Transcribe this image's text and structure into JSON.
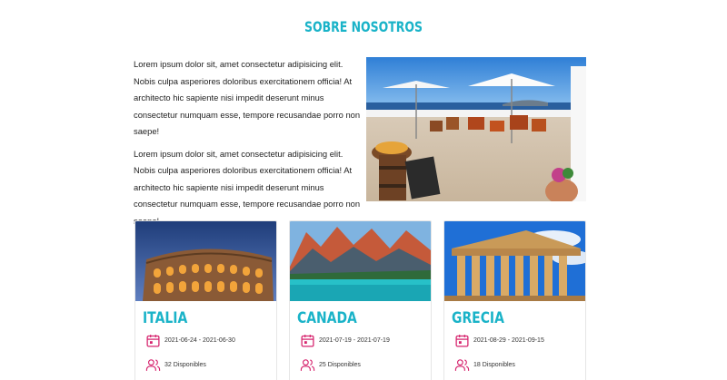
{
  "about": {
    "title": "SOBRE NOSOTROS",
    "paragraphs": [
      "Lorem ipsum dolor sit, amet consectetur adipisicing elit. Nobis culpa asperiores doloribus exercitationem officia! At architecto hic sapiente nisi impedit deserunt minus consectetur numquam esse, tempore recusandae porro non saepe!",
      "Lorem ipsum dolor sit, amet consectetur adipisicing elit. Nobis culpa asperiores doloribus exercitationem officia! At architecto hic sapiente nisi impedit deserunt minus consectetur numquam esse, tempore recusandae porro non saepe!"
    ]
  },
  "trips": [
    {
      "name": "ITALIA",
      "dates": "2021-06-24 - 2021-06-30",
      "availability": "32 Disponibles"
    },
    {
      "name": "CANADA",
      "dates": "2021-07-19 - 2021-07-19",
      "availability": "25 Disponibles"
    },
    {
      "name": "GRECIA",
      "dates": "2021-08-29 - 2021-09-15",
      "availability": "18 Disponibles"
    }
  ],
  "colors": {
    "accent": "#1ab3c8",
    "icon": "#d6246e"
  },
  "icons": {
    "date": "calendar-icon",
    "availability": "users-icon"
  }
}
